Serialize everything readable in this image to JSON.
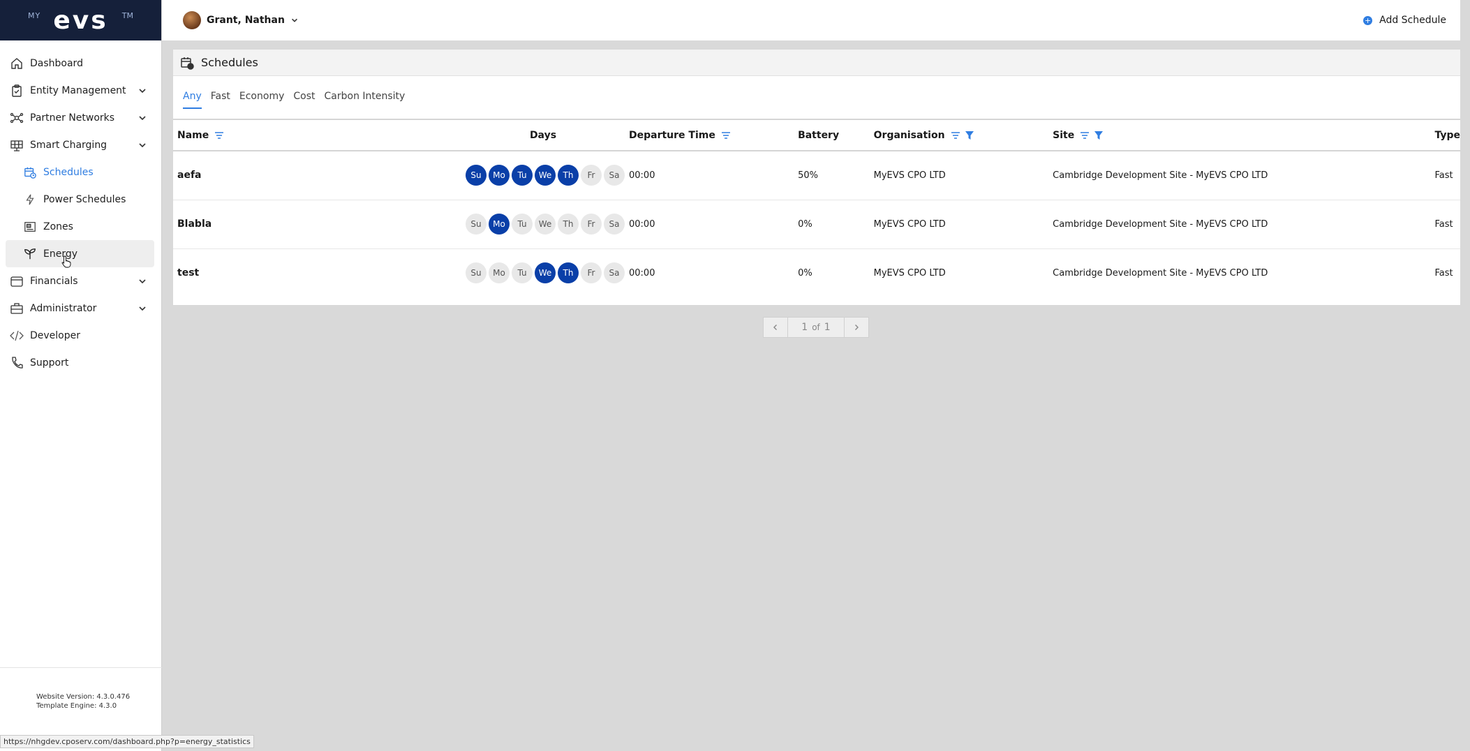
{
  "brand": {
    "prefix": "MY",
    "name": "evs",
    "suffix": "TM"
  },
  "sidebar": {
    "items": [
      {
        "label": "Dashboard",
        "icon": "home-icon"
      },
      {
        "label": "Entity Management",
        "icon": "clipboard-icon",
        "expandable": true
      },
      {
        "label": "Partner Networks",
        "icon": "network-icon",
        "expandable": true
      },
      {
        "label": "Smart Charging",
        "icon": "solar-panel-icon",
        "expandable": true,
        "expanded": true
      }
    ],
    "sub_items": [
      {
        "label": "Schedules",
        "icon": "calendar-clock-icon",
        "active": true
      },
      {
        "label": "Power Schedules",
        "icon": "lightning-icon"
      },
      {
        "label": "Zones",
        "icon": "zones-icon"
      },
      {
        "label": "Energy",
        "icon": "sprout-icon",
        "hover": true
      }
    ],
    "items_after": [
      {
        "label": "Financials",
        "icon": "wallet-icon",
        "expandable": true
      },
      {
        "label": "Administrator",
        "icon": "briefcase-icon",
        "expandable": true
      },
      {
        "label": "Developer",
        "icon": "code-icon"
      },
      {
        "label": "Support",
        "icon": "phone-icon"
      }
    ],
    "version_line1": "Website Version: 4.3.0.476",
    "version_line2": "Template Engine: 4.3.0"
  },
  "topbar": {
    "user": "Grant, Nathan",
    "add_schedule": "Add Schedule"
  },
  "panel": {
    "title": "Schedules",
    "tabs": [
      {
        "label": "Any",
        "active": true
      },
      {
        "label": "Fast"
      },
      {
        "label": "Economy"
      },
      {
        "label": "Cost"
      },
      {
        "label": "Carbon Intensity"
      }
    ],
    "columns": {
      "name": "Name",
      "days": "Days",
      "departure": "Departure Time",
      "battery": "Battery",
      "organisation": "Organisation",
      "site": "Site",
      "type": "Type"
    },
    "day_labels": [
      "Su",
      "Mo",
      "Tu",
      "We",
      "Th",
      "Fr",
      "Sa"
    ],
    "rows": [
      {
        "name": "aefa",
        "days_on": [
          true,
          true,
          true,
          true,
          true,
          false,
          false
        ],
        "departure": "00:00",
        "battery": "50%",
        "organisation": "MyEVS CPO LTD",
        "site": "Cambridge Development Site - MyEVS CPO LTD",
        "type": "Fast"
      },
      {
        "name": "Blabla",
        "days_on": [
          false,
          true,
          false,
          false,
          false,
          false,
          false
        ],
        "departure": "00:00",
        "battery": "0%",
        "organisation": "MyEVS CPO LTD",
        "site": "Cambridge Development Site - MyEVS CPO LTD",
        "type": "Fast"
      },
      {
        "name": "test",
        "days_on": [
          false,
          false,
          false,
          true,
          true,
          false,
          false
        ],
        "departure": "00:00",
        "battery": "0%",
        "organisation": "MyEVS CPO LTD",
        "site": "Cambridge Development Site - MyEVS CPO LTD",
        "type": "Fast"
      }
    ]
  },
  "pager": {
    "current": "1",
    "of": "of",
    "total": "1"
  },
  "status_url": "https://nhgdev.cposerv.com/dashboard.php?p=energy_statistics",
  "colors": {
    "accent": "#2f7de1",
    "day_on": "#0a3fa8",
    "logo_bg": "#15203a"
  }
}
